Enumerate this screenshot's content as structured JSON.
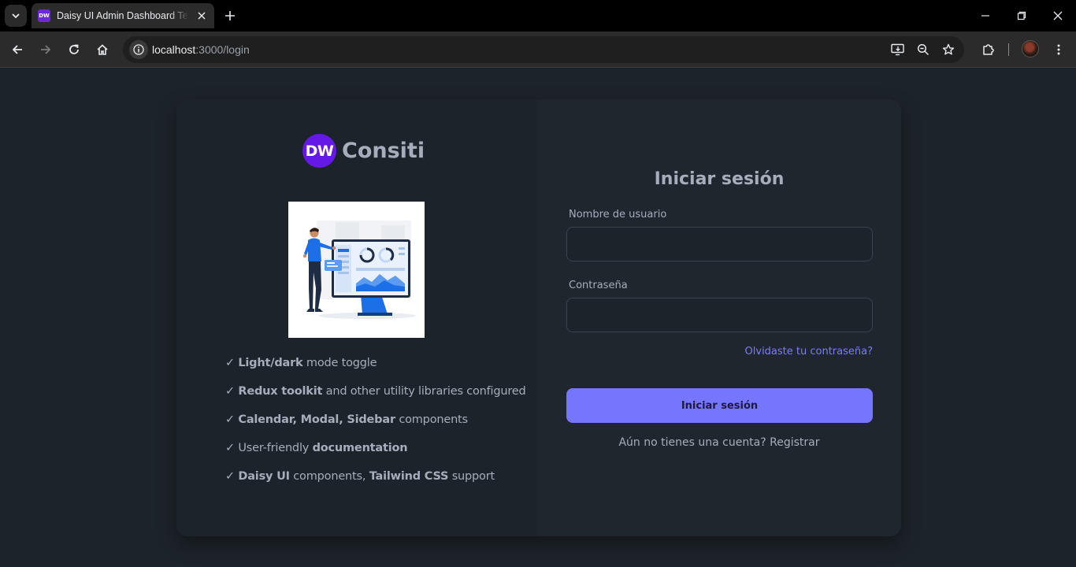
{
  "browser": {
    "tab": {
      "favicon_text": "DW",
      "title": "Daisy UI Admin Dashboard Template"
    },
    "url": {
      "host": "localhost",
      "rest": ":3000/login"
    }
  },
  "brand": {
    "logo_text": "DW",
    "name": "Consiti"
  },
  "features": [
    {
      "check": "✓",
      "bold": "Light/dark",
      "text": " mode toggle"
    },
    {
      "check": "✓",
      "bold": "Redux toolkit",
      "text": " and other utility libraries configured"
    },
    {
      "check": "✓",
      "bold": "Calendar, Modal, Sidebar",
      "text": " components"
    },
    {
      "check": "✓",
      "pre": "User-friendly ",
      "bold": "documentation",
      "text": ""
    },
    {
      "check": "✓",
      "bold": "Daisy UI",
      "text": " components, ",
      "bold2": "Tailwind CSS",
      "text2": " support"
    }
  ],
  "login": {
    "title": "Iniciar sesión",
    "username_label": "Nombre de usuario",
    "username_value": "",
    "password_label": "Contraseña",
    "password_value": "",
    "forgot_link": "Olvidaste tu contraseña?",
    "submit_label": "Iniciar sesión",
    "register_prompt": "Aún no tienes una cuenta?",
    "register_link": "Registrar"
  },
  "colors": {
    "page_bg": "#1d232a",
    "panel_bg": "#20262e",
    "primary": "#7676fd",
    "brand_logo": "#6419e6",
    "link": "#7b7bff"
  }
}
